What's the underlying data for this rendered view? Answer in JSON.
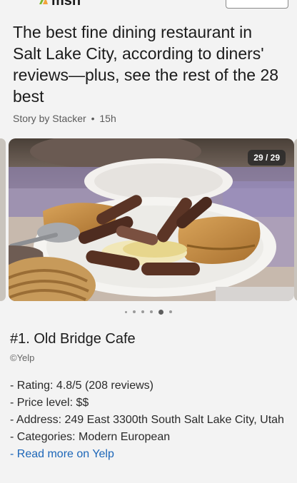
{
  "header": {
    "brand_text": "msn",
    "button_label": ""
  },
  "article": {
    "title": "The best fine dining restaurant in Salt Lake City, according to diners' reviews—plus, see the rest of the 28 best",
    "byline_author": "Story by Stacker",
    "byline_separator": "•",
    "byline_time": "15h"
  },
  "gallery": {
    "counter": "29 / 29",
    "image_subject": "plate of grilled cevapi sausages with rice and burek pastry",
    "pagination": {
      "dot_count": 6,
      "active_index": 4
    }
  },
  "listing": {
    "heading": "#1. Old Bridge Cafe",
    "credit": "©Yelp",
    "rating": "- Rating: 4.8/5 (208 reviews)",
    "price": "- Price level: $$",
    "address": "- Address: 249 East 3300th South Salt Lake City, Utah",
    "categories": "- Categories: Modern European",
    "link_prefix": "- ",
    "link_text": "Read more on Yelp"
  },
  "colors": {
    "background": "#f3f3f3",
    "link": "#1c66b8",
    "counter_bg": "#2f2f2f",
    "msn_accent_green": "#7cb82f",
    "msn_accent_orange": "#f2a33a"
  }
}
